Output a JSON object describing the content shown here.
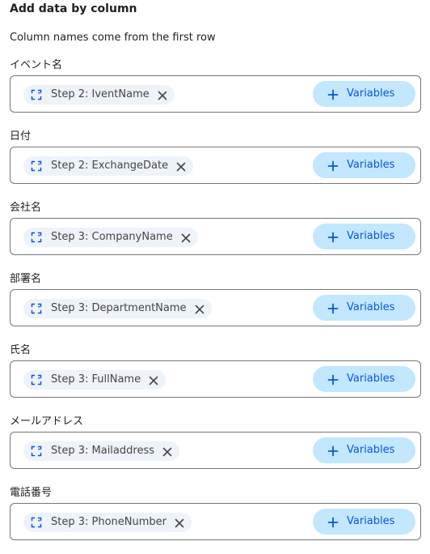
{
  "header": {
    "title": "Add data by column",
    "subtitle": "Column names come from the first row"
  },
  "colors": {
    "chip_bg": "#eef2f9",
    "button_bg": "#c2e7ff",
    "button_text": "#0b57d0",
    "border": "#747775"
  },
  "fields": [
    {
      "label": "イベント名",
      "chip": "Step 2: IventName",
      "chip_icon": "variable-brackets-icon",
      "button": "Variables"
    },
    {
      "label": "日付",
      "chip": "Step 2: ExchangeDate",
      "chip_icon": "variable-brackets-icon",
      "button": "Variables"
    },
    {
      "label": "会社名",
      "chip": "Step 3: CompanyName",
      "chip_icon": "variable-brackets-icon",
      "button": "Variables"
    },
    {
      "label": "部署名",
      "chip": "Step 3: DepartmentName",
      "chip_icon": "variable-brackets-icon",
      "button": "Variables"
    },
    {
      "label": "氏名",
      "chip": "Step 3: FullName",
      "chip_icon": "variable-brackets-icon",
      "button": "Variables"
    },
    {
      "label": "メールアドレス",
      "chip": "Step 3: Mailaddress",
      "chip_icon": "variable-brackets-icon",
      "button": "Variables"
    },
    {
      "label": "電話番号",
      "chip": "Step 3: PhoneNumber",
      "chip_icon": "variable-brackets-icon",
      "button": "Variables"
    }
  ]
}
